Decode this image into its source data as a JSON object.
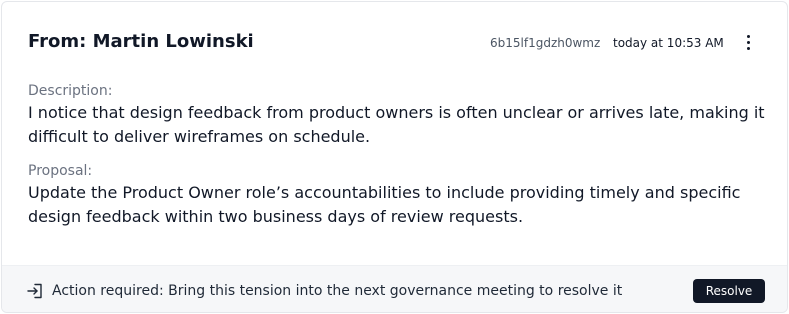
{
  "header": {
    "title": "From: Martin Lowinski",
    "tension_id": "6b15lf1gdzh0wmz",
    "timestamp": "today at 10:53 AM",
    "more_icon": "more-vertical-icon"
  },
  "body": {
    "description_label": "Description:",
    "description_text": "I notice that design feedback from product owners is often unclear or arrives late, making it difficult to deliver wireframes on schedule.",
    "proposal_label": "Proposal:",
    "proposal_text": "Update the Product Owner role’s accountabilities to include providing timely and specific design feedback within two business days of review requests."
  },
  "footer": {
    "icon": "enter-icon",
    "action_text": "Action required: Bring this tension into the next governance meeting to resolve it",
    "resolve_label": "Resolve"
  },
  "colors": {
    "primary_button": "#111827",
    "footer_bg": "#f6f7f9",
    "label_gray": "#6b7280"
  }
}
